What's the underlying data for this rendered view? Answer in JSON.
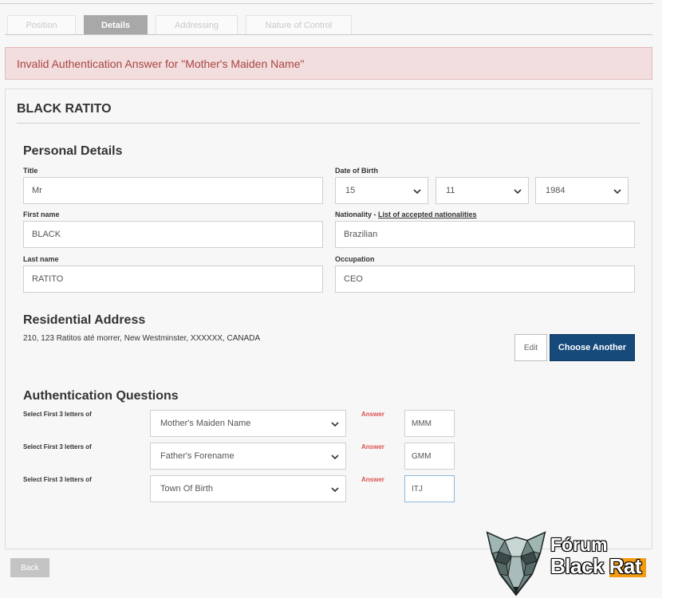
{
  "tabs": [
    {
      "label": "Position",
      "active": false
    },
    {
      "label": "Details",
      "active": true
    },
    {
      "label": "Addressing",
      "active": false
    },
    {
      "label": "Nature of Control",
      "active": false
    }
  ],
  "alert": {
    "message": "Invalid Authentication Answer for \"Mother's Maiden Name\""
  },
  "panel": {
    "title": "BLACK RATITO"
  },
  "personal": {
    "heading": "Personal Details",
    "title_label": "Title",
    "title_value": "Mr",
    "dob_label": "Date of Birth",
    "dob_day": "15",
    "dob_month": "11",
    "dob_year": "1984",
    "first_name_label": "First name",
    "first_name_value": "BLACK",
    "nationality_label": "Nationality - ",
    "nationality_link": "List of accepted nationalities",
    "nationality_value": "Brazilian",
    "last_name_label": "Last name",
    "last_name_value": "RATITO",
    "occupation_label": "Occupation",
    "occupation_value": "CEO"
  },
  "address": {
    "heading": "Residential Address",
    "text": "210, 123 Ratitos até morrer, New Westminster, XXXXXX, CANADA",
    "edit_label": "Edit",
    "choose_label": "Choose Another"
  },
  "auth": {
    "heading": "Authentication Questions",
    "questions": [
      {
        "label": "Select First 3 letters of",
        "question": "Mother's Maiden Name",
        "answer_label": "Answer",
        "answer": "MMM"
      },
      {
        "label": "Select First 3 letters of",
        "question": "Father's Forename",
        "answer_label": "Answer",
        "answer": "GMM"
      },
      {
        "label": "Select First 3 letters of",
        "question": "Town Of Birth",
        "answer_label": "Answer",
        "answer": "ITJ"
      }
    ]
  },
  "footer": {
    "back_label": "Back"
  },
  "watermark": {
    "line1": "Fórum",
    "line2": "Black Rat"
  },
  "colors": {
    "primary_button": "#154a7a",
    "alert_text": "#a94442",
    "answer_label": "#d9534f",
    "next_button": "#f39c12"
  }
}
